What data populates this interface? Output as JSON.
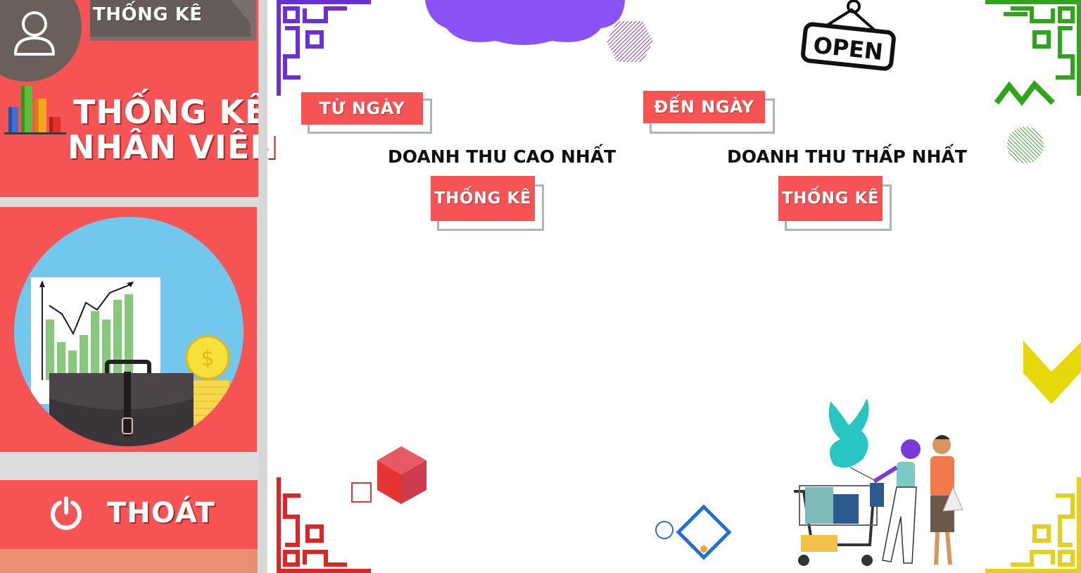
{
  "sidebar": {
    "tab_label": "THỐNG KÊ",
    "title_line1": "THỐNG KÊ",
    "title_line2": "NHÂN VIÊN",
    "exit_label": "THOÁT"
  },
  "main": {
    "from_date_label": "TỪ NGÀY",
    "to_date_label": "ĐẾN NGÀY",
    "highest_heading": "DOANH THU CAO NHẤT",
    "lowest_heading": "DOANH THU THẤP NHẤT",
    "stat_button_label": "THỐNG KÊ",
    "open_sign": "OPEN"
  },
  "colors": {
    "accent": "#f65454",
    "tab": "#655b58",
    "divider": "#d7d7d7",
    "frame": "#a9b4bd",
    "cloud": "#8a52f5"
  },
  "icons": [
    "user-icon",
    "bar-chart-icon",
    "power-icon",
    "briefcase-icon",
    "dollar-coin-icon",
    "open-sign-icon"
  ]
}
